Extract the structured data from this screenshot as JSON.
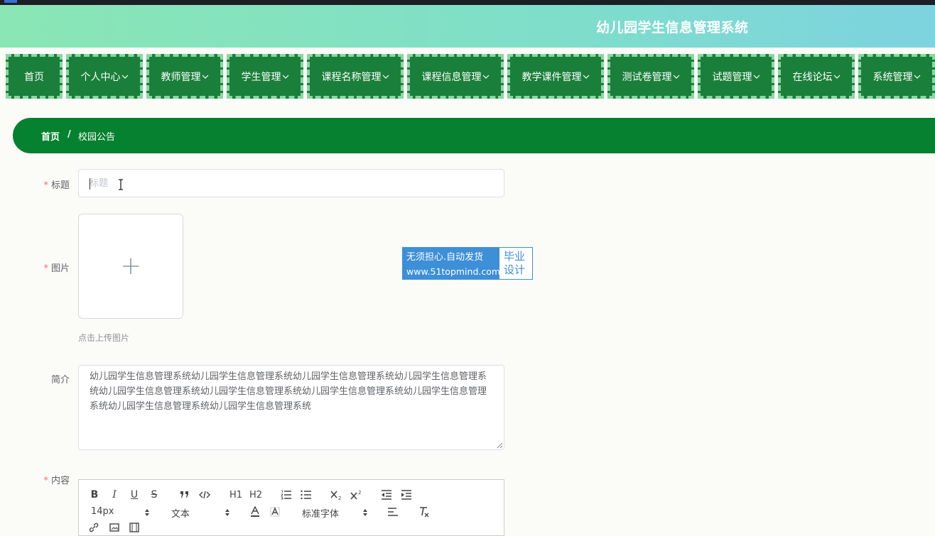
{
  "header": {
    "title": "幼儿园学生信息管理系统"
  },
  "nav": {
    "items": [
      {
        "label": "首页",
        "dropdown": false
      },
      {
        "label": "个人中心",
        "dropdown": true
      },
      {
        "label": "教师管理",
        "dropdown": true
      },
      {
        "label": "学生管理",
        "dropdown": true
      },
      {
        "label": "课程名称管理",
        "dropdown": true
      },
      {
        "label": "课程信息管理",
        "dropdown": true
      },
      {
        "label": "教学课件管理",
        "dropdown": true
      },
      {
        "label": "测试卷管理",
        "dropdown": true
      },
      {
        "label": "试题管理",
        "dropdown": true
      },
      {
        "label": "在线论坛",
        "dropdown": true
      },
      {
        "label": "系统管理",
        "dropdown": true
      }
    ]
  },
  "breadcrumb": {
    "home": "首页",
    "separator": "/",
    "current": "校园公告"
  },
  "form": {
    "required_mark": "*",
    "title_label": "标题",
    "title_placeholder": "标题",
    "title_value": "",
    "image_label": "图片",
    "upload_tip": "点击上传图片",
    "intro_label": "简介",
    "intro_value": "幼儿园学生信息管理系统幼儿园学生信息管理系统幼儿园学生信息管理系统幼儿园学生信息管理系统幼儿园学生信息管理系统幼儿园学生信息管理系统幼儿园学生信息管理系统幼儿园学生信息管理系统幼儿园学生信息管理系统幼儿园学生信息管理系统",
    "content_label": "内容"
  },
  "editor": {
    "font_size": "14px",
    "header_type": "文本",
    "font_family": "标准字体",
    "h1": "H1",
    "h2": "H2",
    "bold": "B",
    "italic": "I",
    "underline": "U",
    "strike": "S"
  },
  "watermark": {
    "line1": "无须担心.自动发货",
    "line2": "www.51topmind.com",
    "side1": "毕业",
    "side2": "设计"
  },
  "colors": {
    "nav_bg": "#1a7f3a",
    "breadcrumb_bg": "#06812f",
    "header_gradient_start": "#8ae6b4",
    "header_gradient_end": "#7dd3e0",
    "required": "#f56c6c"
  }
}
